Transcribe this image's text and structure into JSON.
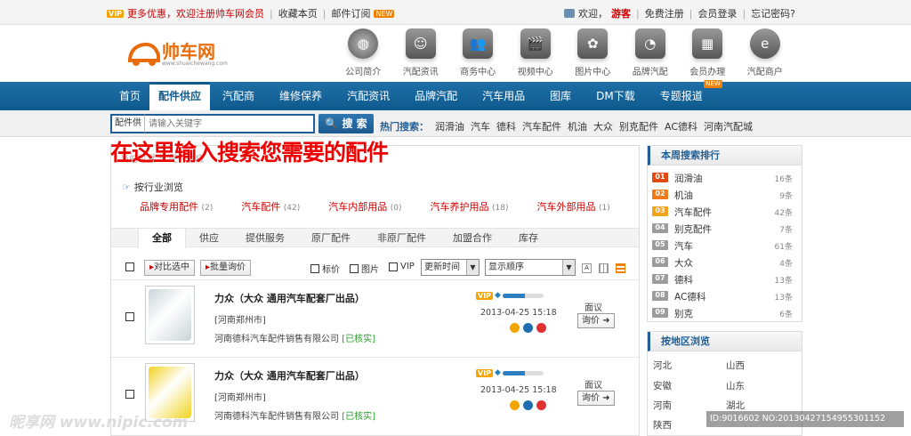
{
  "topbar": {
    "vip": "VIP",
    "promo": "更多优惠，欢迎注册帅车网会员",
    "bookmark": "收藏本页",
    "subscribe": "邮件订阅",
    "new_badge": "NEW",
    "welcome": "欢迎，",
    "guest": "游客",
    "register": "免费注册",
    "login": "会员登录",
    "forgot": "忘记密码?"
  },
  "logo": {
    "text": "帅车网",
    "url": "www.shuaichewang.com"
  },
  "top_icons": [
    {
      "label": "公司简介",
      "icon": "globe-icon"
    },
    {
      "label": "汽配资讯",
      "icon": "face-icon"
    },
    {
      "label": "商务中心",
      "icon": "people-icon"
    },
    {
      "label": "视频中心",
      "icon": "clapper-icon"
    },
    {
      "label": "图片中心",
      "icon": "flower-icon"
    },
    {
      "label": "品牌汽配",
      "icon": "rss-icon"
    },
    {
      "label": "会员办理",
      "icon": "grid-icon"
    },
    {
      "label": "汽配商户",
      "icon": "ie-icon"
    }
  ],
  "main_nav": [
    "首页",
    "配件供应",
    "汽配商",
    "维修保养",
    "汽配资讯",
    "品牌汽配",
    "汽车用品",
    "图库",
    "DM下载",
    "专题报道"
  ],
  "main_nav_new": "NEW",
  "search": {
    "category": "配件供",
    "placeholder": "请输入关键字",
    "button": "搜 索",
    "hot_label": "热门搜索：",
    "hot": [
      "润滑油",
      "汽车",
      "德科",
      "汽车配件",
      "机油",
      "大众",
      "别克配件",
      "AC德科",
      "河南汽配城"
    ]
  },
  "annotation": "在这里输入搜索您需要的配件",
  "main": {
    "breadcrumb": "当前位置 > 配件供应",
    "browse_title": "按行业浏览",
    "categories": [
      {
        "name": "品牌专用配件",
        "count": "(2)"
      },
      {
        "name": "汽车配件",
        "count": "(42)"
      },
      {
        "name": "汽车内部用品",
        "count": "(0)"
      },
      {
        "name": "汽车养护用品",
        "count": "(18)"
      },
      {
        "name": "汽车外部用品",
        "count": "(1)"
      }
    ],
    "tabs": [
      "全部",
      "供应",
      "提供服务",
      "原厂配件",
      "非原厂配件",
      "加盟合作",
      "库存"
    ],
    "toolbar": {
      "compare": "对比选中",
      "batch": "批量询价",
      "f_price": "标价",
      "f_image": "图片",
      "f_vip": "VIP",
      "sort": "更新时间",
      "display": "显示顺序"
    },
    "listings": [
      {
        "title": "力众（大众 通用汽车配套厂出品）",
        "location": "[河南郑州市]",
        "company": "河南德科汽车配件销售有限公司",
        "verified": "[已核实]",
        "vip": "VIP",
        "date": "2013-04-25 15:18",
        "price": "面议",
        "ask": "询价",
        "color": "#c9d4d8",
        "level": 0.55
      },
      {
        "title": "力众（大众 通用汽车配套厂出品）",
        "location": "[河南郑州市]",
        "company": "河南德科汽车配件销售有限公司",
        "verified": "[已核实]",
        "vip": "VIP",
        "date": "2013-04-25 15:18",
        "price": "面议",
        "ask": "询价",
        "color": "#f1d320",
        "level": 0.55
      }
    ]
  },
  "ranking": {
    "title": "本周搜索排行",
    "items": [
      {
        "n": "01",
        "k": "润滑油",
        "c": "16条"
      },
      {
        "n": "02",
        "k": "机油",
        "c": "9条"
      },
      {
        "n": "03",
        "k": "汽车配件",
        "c": "42条"
      },
      {
        "n": "04",
        "k": "别克配件",
        "c": "7条"
      },
      {
        "n": "05",
        "k": "汽车",
        "c": "61条"
      },
      {
        "n": "06",
        "k": "大众",
        "c": "4条"
      },
      {
        "n": "07",
        "k": "德科",
        "c": "13条"
      },
      {
        "n": "08",
        "k": "AC德科",
        "c": "13条"
      },
      {
        "n": "09",
        "k": "别克",
        "c": "6条"
      }
    ]
  },
  "regions": {
    "title": "按地区浏览",
    "items": [
      "河北",
      "山西",
      "安徽",
      "山东",
      "河南",
      "湖北",
      "陕西"
    ]
  },
  "watermarks": {
    "left": "昵享网 www.nipic.com",
    "right": "ID:9016602 NO:20130427154955301152"
  }
}
